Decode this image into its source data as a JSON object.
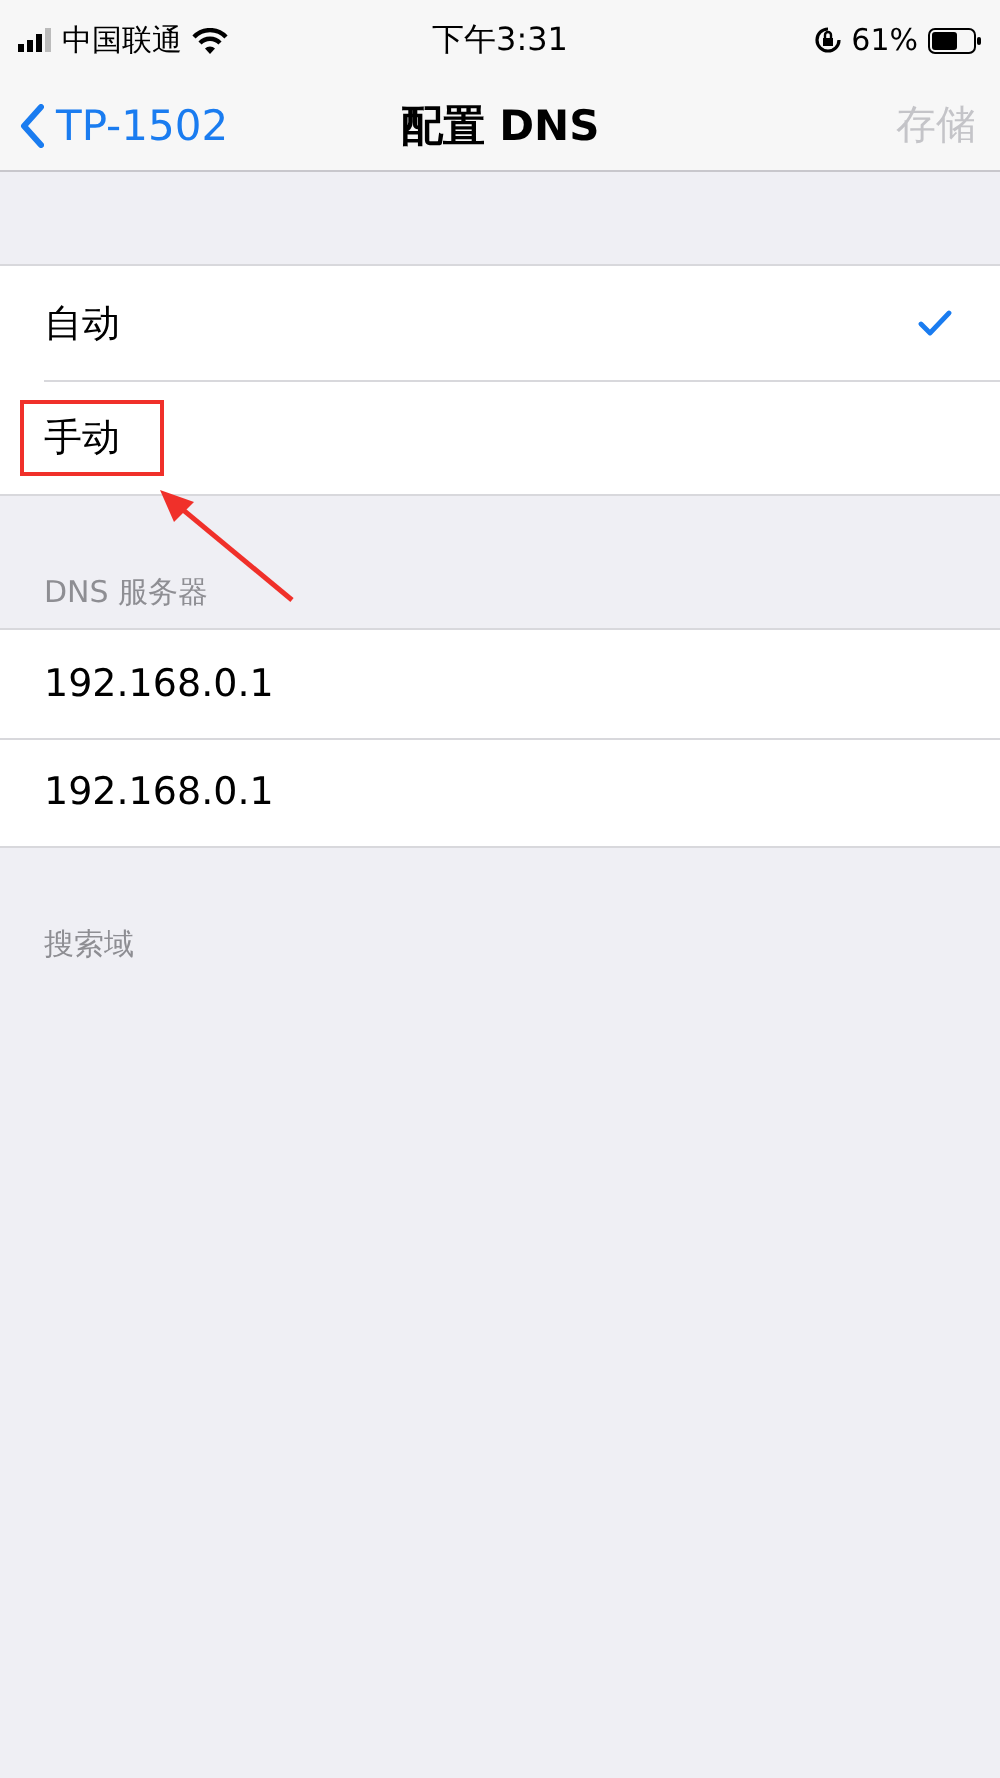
{
  "status_bar": {
    "carrier": "中国联通",
    "time": "下午3:31",
    "battery_percent": "61%"
  },
  "nav_bar": {
    "back_label": "TP-1502",
    "title": "配置 DNS",
    "save": {
      "label": "存储",
      "disabled": true
    }
  },
  "options": [
    {
      "label": "自动",
      "selected": true,
      "highlighted": false
    },
    {
      "label": "手动",
      "selected": false,
      "highlighted": true
    }
  ],
  "dns_section": {
    "header": "DNS 服务器",
    "servers": [
      "192.168.0.1",
      "192.168.0.1"
    ]
  },
  "search_domains": {
    "header": "搜索域"
  }
}
